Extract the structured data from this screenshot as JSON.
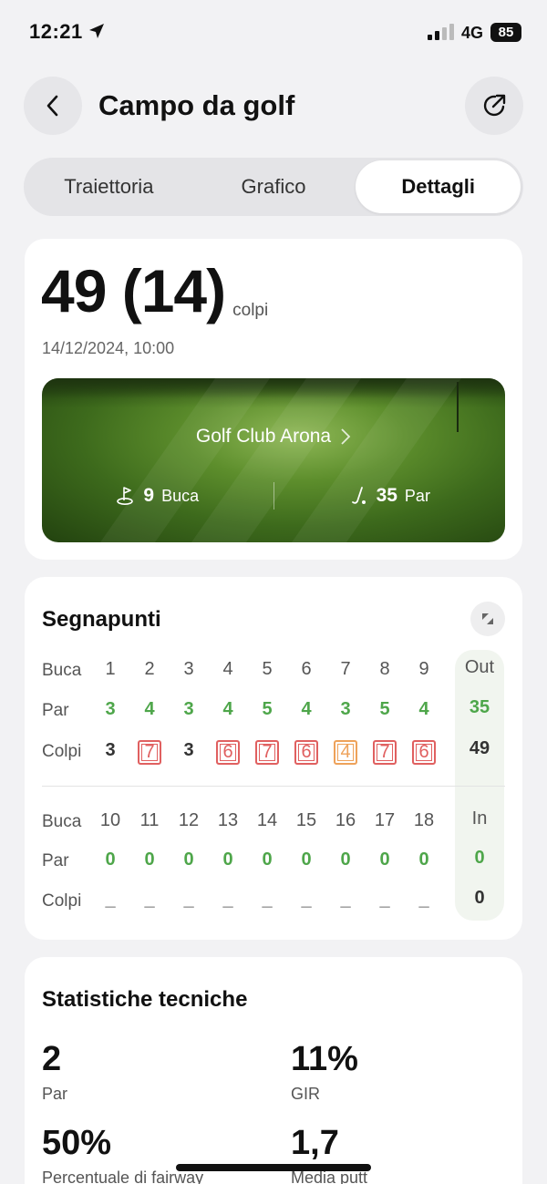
{
  "status": {
    "time": "12:21",
    "network": "4G",
    "battery": "85"
  },
  "header": {
    "title": "Campo da golf"
  },
  "tabs": [
    {
      "label": "Traiettoria",
      "active": false
    },
    {
      "label": "Grafico",
      "active": false
    },
    {
      "label": "Dettagli",
      "active": true
    }
  ],
  "summary": {
    "score": "49 (14)",
    "unit": "colpi",
    "date": "14/12/2024, 10:00",
    "course_name": "Golf Club Arona",
    "holes_count": "9",
    "holes_label": "Buca",
    "par_total": "35",
    "par_label": "Par"
  },
  "scorecard": {
    "title": "Segnapunti",
    "labels": {
      "hole": "Buca",
      "par": "Par",
      "strokes": "Colpi"
    },
    "front": {
      "holes": [
        "1",
        "2",
        "3",
        "4",
        "5",
        "6",
        "7",
        "8",
        "9"
      ],
      "par": [
        "3",
        "4",
        "3",
        "4",
        "5",
        "4",
        "3",
        "5",
        "4"
      ],
      "strokes": [
        "3",
        "7",
        "3",
        "6",
        "7",
        "6",
        "4",
        "7",
        "6"
      ],
      "strokes_style": [
        "plain",
        "red",
        "plain",
        "red",
        "red",
        "red",
        "orange",
        "red",
        "red"
      ],
      "total_label": "Out",
      "total_par": "35",
      "total_strokes": "49"
    },
    "back": {
      "holes": [
        "10",
        "11",
        "12",
        "13",
        "14",
        "15",
        "16",
        "17",
        "18"
      ],
      "par": [
        "0",
        "0",
        "0",
        "0",
        "0",
        "0",
        "0",
        "0",
        "0"
      ],
      "strokes": [
        "_",
        "_",
        "_",
        "_",
        "_",
        "_",
        "_",
        "_",
        "_"
      ],
      "total_label": "In",
      "total_par": "0",
      "total_strokes": "0"
    }
  },
  "stats": {
    "title": "Statistiche tecniche",
    "items": [
      {
        "value": "2",
        "label": "Par"
      },
      {
        "value": "11%",
        "label": "GIR"
      },
      {
        "value": "50%",
        "label": "Percentuale di fairway"
      },
      {
        "value": "1,7",
        "label": "Media putt"
      }
    ]
  },
  "colors": {
    "accent_green": "#4ea64a",
    "over_par_red": "#e06060",
    "bogey_orange": "#eea25a"
  }
}
